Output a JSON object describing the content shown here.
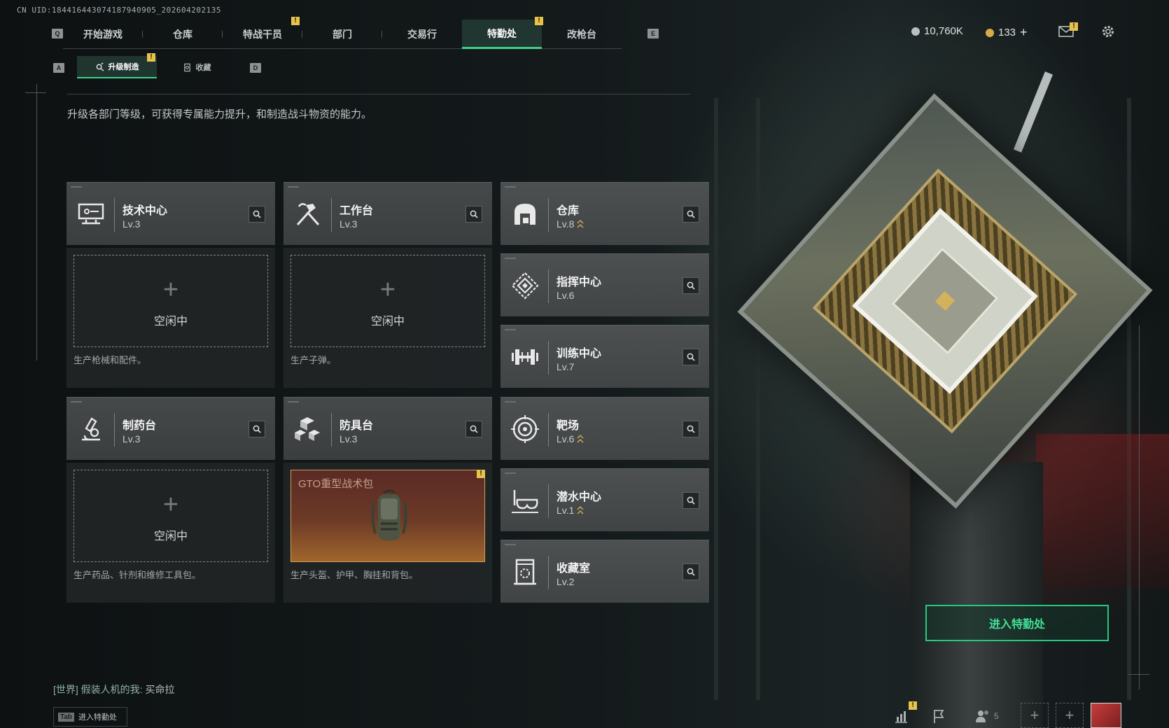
{
  "uid": "CN UID:184416443074187940905_202604202135",
  "nav": {
    "left_key": "Q",
    "right_key": "E",
    "tabs": [
      {
        "label": "开始游戏",
        "active": false,
        "badge": ""
      },
      {
        "label": "仓库",
        "active": false,
        "badge": ""
      },
      {
        "label": "特战干员",
        "active": false,
        "badge": "!"
      },
      {
        "label": "部门",
        "active": false,
        "badge": ""
      },
      {
        "label": "交易行",
        "active": false,
        "badge": ""
      },
      {
        "label": "特勤处",
        "active": true,
        "badge": "!"
      },
      {
        "label": "改枪台",
        "active": false,
        "badge": ""
      }
    ]
  },
  "subnav": {
    "left_key": "A",
    "right_key": "D",
    "tabs": [
      {
        "label": "升级制造",
        "active": true,
        "icon": "upgrade-gear-icon",
        "badge": "!"
      },
      {
        "label": "收藏",
        "active": false,
        "icon": "collection-icon",
        "badge": ""
      }
    ]
  },
  "currency": {
    "silver": "10,760K",
    "gold": "133",
    "plus": "+",
    "silver_color": "#b9bfc2",
    "gold_color": "#d9a94a"
  },
  "mail_badge": "!",
  "description": "升级各部门等级，可获得专属能力提升，和制造战斗物资的能力。",
  "departments_left": [
    {
      "name": "技术中心",
      "level": "Lv.3",
      "icon": "tech-center-icon",
      "upgradable": false
    },
    {
      "name": "工作台",
      "level": "Lv.3",
      "icon": "workbench-icon",
      "upgradable": false
    },
    {
      "name": "制药台",
      "level": "Lv.3",
      "icon": "pharmacy-icon",
      "upgradable": false
    },
    {
      "name": "防具台",
      "level": "Lv.3",
      "icon": "armor-bench-icon",
      "upgradable": false
    }
  ],
  "production": [
    {
      "idle": "空闲中",
      "plus": "+",
      "note": "生产枪械和配件。"
    },
    {
      "idle": "空闲中",
      "plus": "+",
      "note": "生产子弹。"
    },
    {
      "idle": "空闲中",
      "plus": "+",
      "note": "生产药品、针剂和维修工具包。"
    },
    {
      "item": "GTO重型战术包",
      "note": "生产头盔、护甲、胸挂和背包。",
      "badge": "!"
    }
  ],
  "departments_right": [
    {
      "name": "仓库",
      "level": "Lv.8",
      "icon": "storage-icon",
      "upgradable": true
    },
    {
      "name": "指挥中心",
      "level": "Lv.6",
      "icon": "command-center-icon",
      "upgradable": false
    },
    {
      "name": "训练中心",
      "level": "Lv.7",
      "icon": "training-center-icon",
      "upgradable": false
    },
    {
      "name": "靶场",
      "level": "Lv.6",
      "icon": "shooting-range-icon",
      "upgradable": true
    },
    {
      "name": "潜水中心",
      "level": "Lv.1",
      "icon": "diving-center-icon",
      "upgradable": true
    },
    {
      "name": "收藏室",
      "level": "Lv.2",
      "icon": "collection-room-icon",
      "upgradable": false
    }
  ],
  "enter_button": "进入特勤处",
  "chat": {
    "channel": "[世界]",
    "sender": "假装人机的我:",
    "message": "买命拉"
  },
  "tab_hint": {
    "key": "Tab",
    "label": "进入特勤处"
  },
  "bottom": {
    "friends_count": "5",
    "stats_badge": "!"
  },
  "colors": {
    "accent": "#3fd08e",
    "badge": "#e8c24a",
    "upgrade_arrow": "#c9a95a"
  }
}
